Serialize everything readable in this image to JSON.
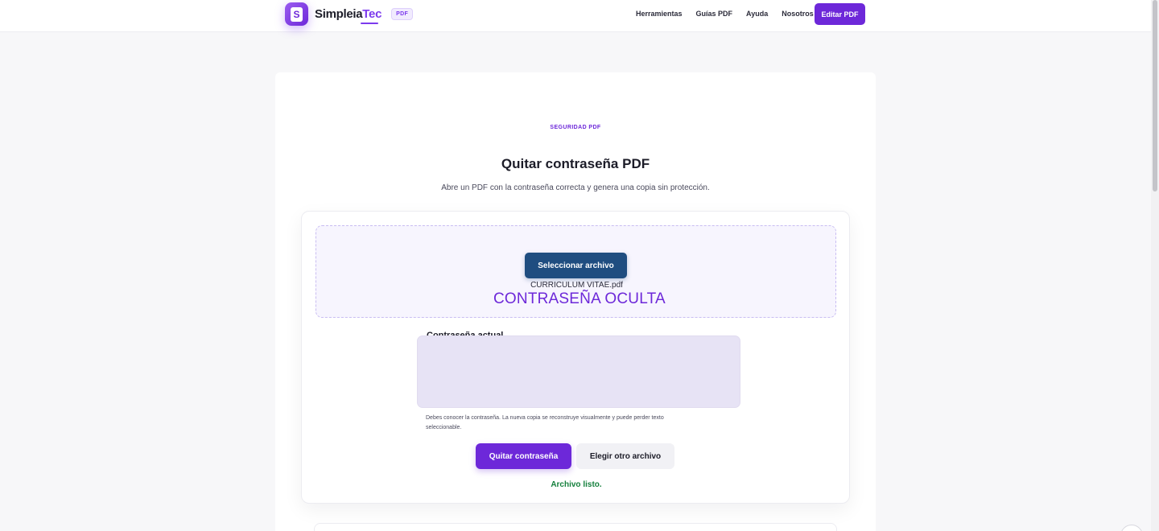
{
  "header": {
    "brand_main": "Simpleia",
    "brand_accent": "Tec",
    "brand_badge": "PDF",
    "brand_mark": "S",
    "nav": [
      "Herramientas",
      "Guías PDF",
      "Ayuda",
      "Nosotros"
    ],
    "cta_label": "Editar PDF"
  },
  "hero": {
    "eyebrow": "SEGURIDAD PDF",
    "title": "Quitar contraseña PDF",
    "subtitle": "Abre un PDF con la contraseña correcta y genera una copia sin protección."
  },
  "tool": {
    "select_button": "Seleccionar archivo",
    "file_name": "CURRICULUM VITAE.pdf",
    "hidden_label": "CONTRASEÑA OCULTA",
    "password_label": "Contraseña actual",
    "password_value": "",
    "help_text": "Debes conocer la contraseña. La nueva copia se reconstruye visualmente y puede perder texto seleccionable.",
    "primary_button": "Quitar contraseña",
    "secondary_button": "Elegir otro archivo",
    "status": "Archivo listo."
  },
  "colors": {
    "accent": "#6d28d9",
    "select_button": "#1f4d80",
    "success": "#15803d",
    "dropzone_bg": "#f7f5fe",
    "input_bg": "#e7e3f5"
  },
  "icons": {
    "brand": "pdf-document-logo-icon"
  }
}
